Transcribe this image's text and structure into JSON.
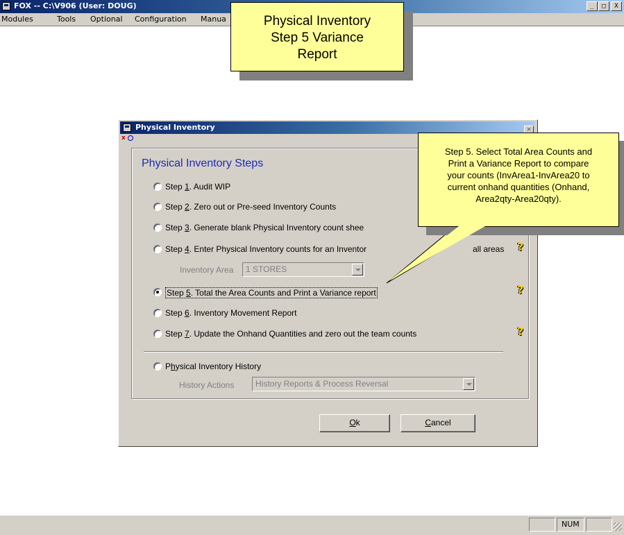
{
  "app": {
    "title": "FOX -- C:\\V906  (User: DOUG)",
    "minimize": "_",
    "maximize": "□",
    "close": "X"
  },
  "menubar": {
    "items": [
      "Modules",
      "Tools",
      "Optional",
      "Configuration",
      "Manua"
    ]
  },
  "callouts": {
    "title_line1": "Physical Inventory",
    "title_line2": "Step 5 Variance",
    "title_line3": "Report",
    "step5_line1": "Step 5. Select Total Area Counts and",
    "step5_line2": "Print a Variance Report to compare",
    "step5_line3": "your counts (InvArea1-InvArea20 to",
    "step5_line4": "current onhand quantities (Onhand,",
    "step5_line5": "Area2qty-Area20qty)."
  },
  "dialog": {
    "title": "Physical Inventory",
    "close": "×",
    "x_marker": "x",
    "group_title": "Physical Inventory Steps",
    "steps": [
      {
        "pre": "Step ",
        "key": "1",
        "post": ".  Audit WIP",
        "checked": false
      },
      {
        "pre": "Step ",
        "key": "2",
        "post": ".  Zero out or Pre-seed Inventory Counts",
        "checked": false
      },
      {
        "pre": "Step ",
        "key": "3",
        "post": ".  Generate blank Physical Inventory count shee",
        "checked": false
      },
      {
        "pre": "Step ",
        "key": "4",
        "post": ".  Enter Physical Inventory counts for an Inventor",
        "checked": false
      },
      {
        "pre": "Step ",
        "key": "5",
        "post": ".  Total the Area Counts and Print a Variance report",
        "checked": true
      },
      {
        "pre": "Step ",
        "key": "6",
        "post": ".  Inventory Movement Report",
        "checked": false
      },
      {
        "pre": "Step ",
        "key": "7",
        "post": ".  Update the Onhand Quantities and zero out the team counts",
        "checked": false
      }
    ],
    "step4_suffix": "all areas",
    "inventory_area_label": "Inventory Area",
    "inventory_area_value": "1  STORES",
    "history": {
      "pre": "P",
      "key": "h",
      "post": "ysical Inventory History",
      "checked": false
    },
    "history_actions_label": "History Actions",
    "history_actions_value": "History Reports & Process Reversal",
    "ok": {
      "key": "O",
      "rest": "k"
    },
    "cancel": {
      "key": "C",
      "rest": "ancel"
    },
    "help_icon": "?"
  },
  "statusbar": {
    "num": "NUM"
  }
}
